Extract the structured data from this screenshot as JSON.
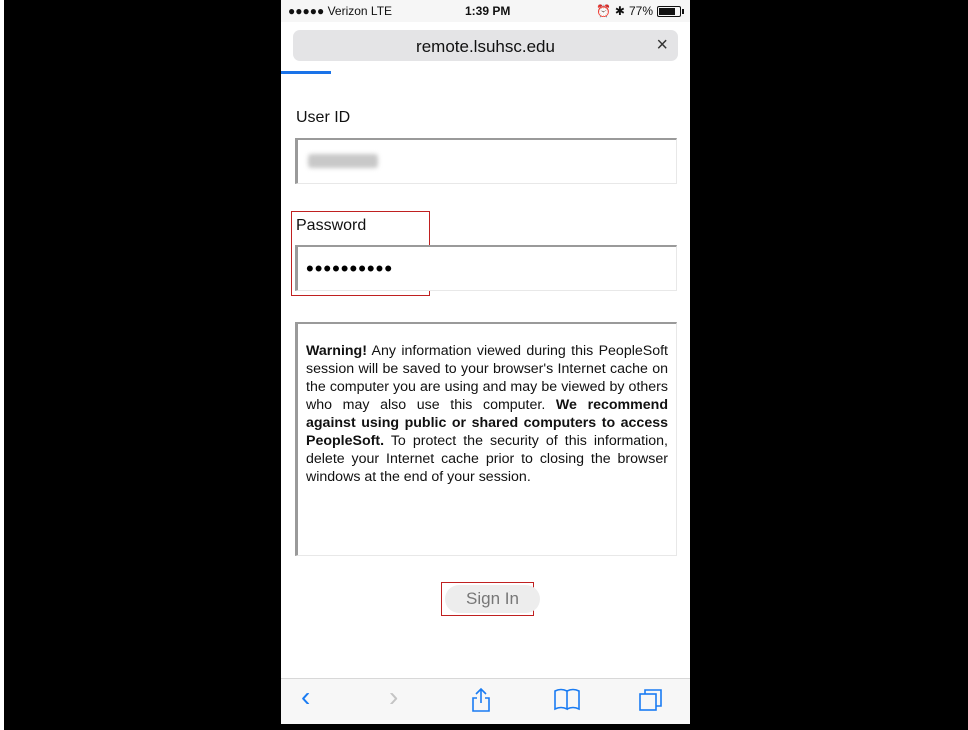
{
  "status": {
    "carrier": "●●●●● Verizon  LTE",
    "time": "1:39 PM",
    "battery": "77%"
  },
  "browser": {
    "url": "remote.lsuhsc.edu",
    "close": "×"
  },
  "form": {
    "user_label": "User ID",
    "password_label": "Password",
    "password_mask": "••••••••••"
  },
  "warning": {
    "lead": "Warning!",
    "part1": " Any information viewed during this PeopleSoft session will be saved to your browser's Internet cache on the computer you are using and may be viewed by others who may also use this computer. ",
    "bold": "We recommend against using public or shared computers to access PeopleSoft.",
    "part2": " To protect the security of this information, delete your Internet cache prior to closing the browser windows at the end of your session."
  },
  "signin": {
    "label": "Sign In"
  },
  "toolbar": {
    "icons": [
      "back-icon",
      "forward-icon",
      "share-icon",
      "bookmarks-icon",
      "tabs-icon"
    ]
  },
  "colors": {
    "accent": "#1a7cf3",
    "highlight": "#c02020"
  }
}
